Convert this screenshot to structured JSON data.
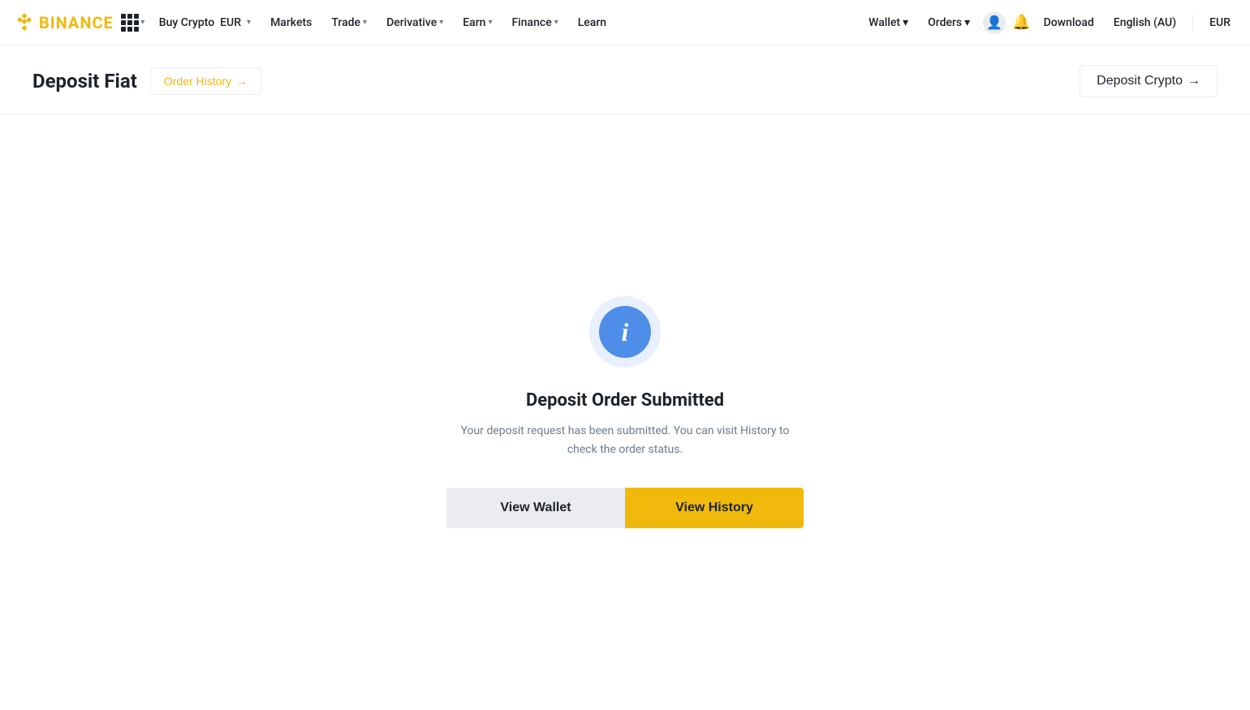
{
  "brand": {
    "name": "BINANCE",
    "logo_symbol": "⬡"
  },
  "nav": {
    "items": [
      {
        "label": "Buy Crypto",
        "has_dropdown": true
      },
      {
        "label": "EUR",
        "has_dropdown": true
      },
      {
        "label": "Markets",
        "has_dropdown": false
      },
      {
        "label": "Trade",
        "has_dropdown": true
      },
      {
        "label": "Derivative",
        "has_dropdown": true
      },
      {
        "label": "Earn",
        "has_dropdown": true
      },
      {
        "label": "Finance",
        "has_dropdown": true
      },
      {
        "label": "Learn",
        "has_dropdown": false
      }
    ],
    "right": {
      "wallet": "Wallet",
      "orders": "Orders",
      "download": "Download",
      "language": "English (AU)",
      "currency": "EUR"
    }
  },
  "page_header": {
    "title": "Deposit Fiat",
    "order_history_label": "Order History",
    "order_history_arrow": "→",
    "deposit_crypto_label": "Deposit Crypto",
    "deposit_crypto_arrow": "→"
  },
  "success_card": {
    "title": "Deposit Order Submitted",
    "description": "Your deposit request has been submitted. You can visit History to check the order status.",
    "btn_wallet": "View Wallet",
    "btn_history": "View History",
    "icon_letter": "i"
  }
}
